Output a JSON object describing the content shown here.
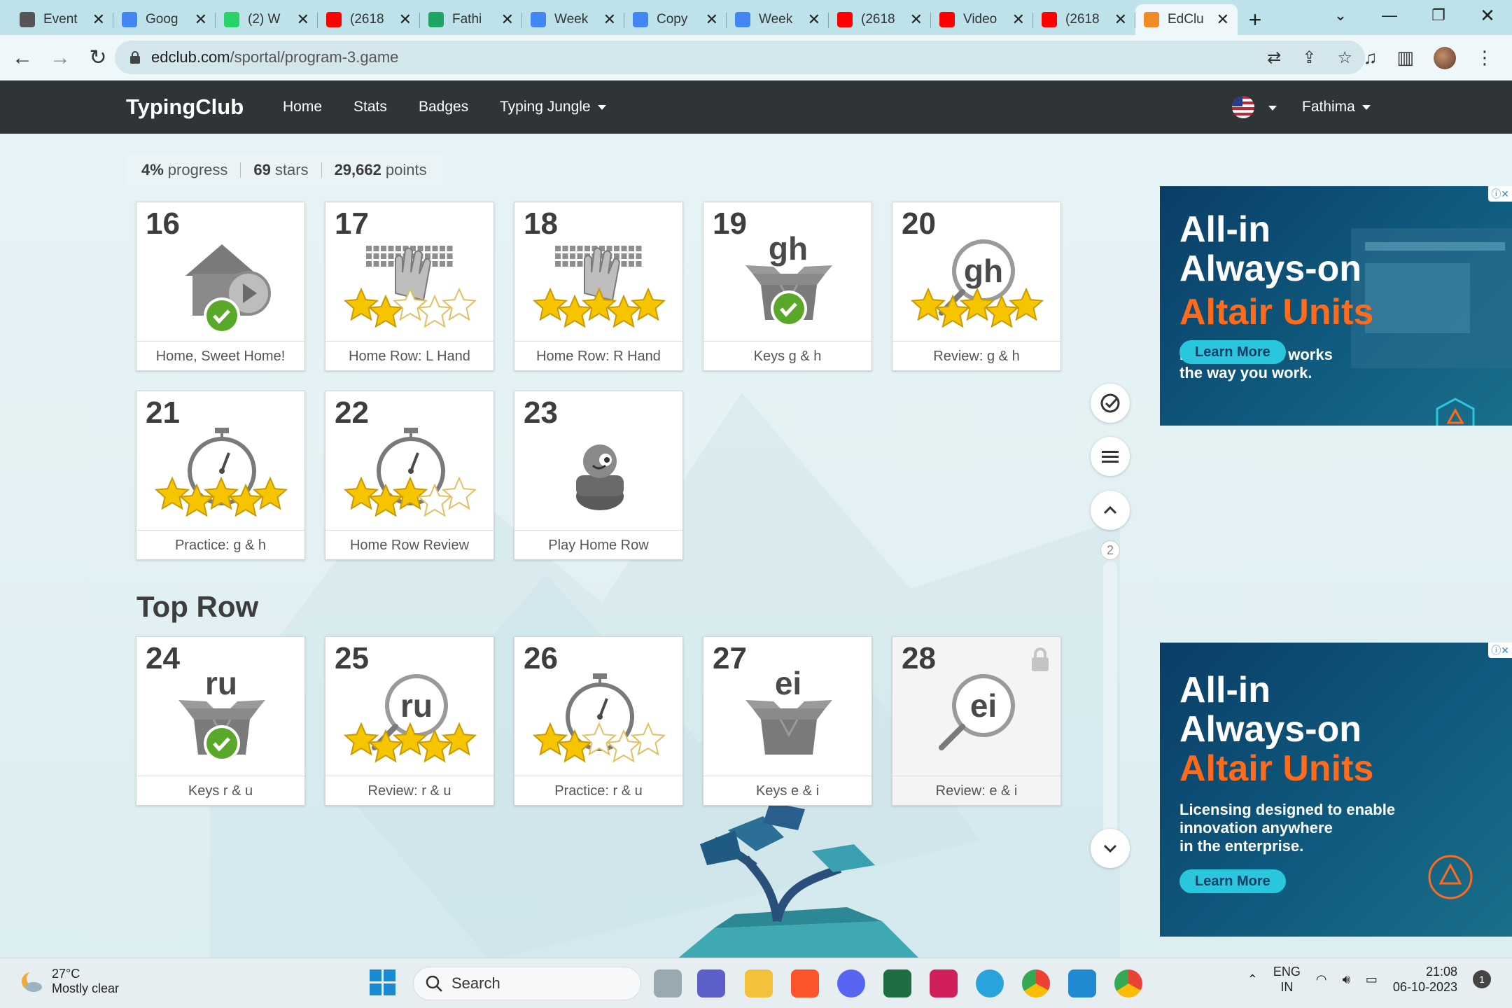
{
  "browser": {
    "tabs": [
      {
        "title": "Event",
        "icon": "openai-icon",
        "color": "#555555"
      },
      {
        "title": "Goog",
        "icon": "google-icon",
        "color": "#4285f4"
      },
      {
        "title": "(2) W",
        "icon": "whatsapp-icon",
        "color": "#25d366"
      },
      {
        "title": "(2618",
        "icon": "youtube-icon",
        "color": "#ff0000"
      },
      {
        "title": "Fathi",
        "icon": "drive-icon",
        "color": "#1fa463"
      },
      {
        "title": "Week",
        "icon": "docs-icon",
        "color": "#4285f4"
      },
      {
        "title": "Copy",
        "icon": "docs-icon",
        "color": "#4285f4"
      },
      {
        "title": "Week",
        "icon": "docs-icon",
        "color": "#4285f4"
      },
      {
        "title": "(2618",
        "icon": "youtube-icon",
        "color": "#ff0000"
      },
      {
        "title": "Video",
        "icon": "youtube-icon",
        "color": "#ff0000"
      },
      {
        "title": "(2618",
        "icon": "youtube-icon",
        "color": "#ff0000"
      },
      {
        "title": "EdClu",
        "icon": "edclub-icon",
        "color": "#f08a24",
        "active": true
      }
    ],
    "url_domain": "edclub.com",
    "url_path": "/sportal/program-3.game"
  },
  "site": {
    "brand": "TypingClub",
    "nav": [
      "Home",
      "Stats",
      "Badges",
      "Typing Jungle"
    ],
    "user": "Fathima"
  },
  "stats": {
    "progress_value": "4%",
    "progress_label": "progress",
    "stars_value": "69",
    "stars_label": "stars",
    "points_value": "29,662",
    "points_label": "points"
  },
  "lessons_row1": [
    {
      "num": "16",
      "label": "Home, Sweet Home!",
      "art": "home-video",
      "stars": 0,
      "done": true
    },
    {
      "num": "17",
      "label": "Home Row: L Hand",
      "art": "keyboard-hand",
      "stars": 2
    },
    {
      "num": "18",
      "label": "Home Row: R Hand",
      "art": "keyboard-hand",
      "stars": 5
    },
    {
      "num": "19",
      "label": "Keys g & h",
      "art": "box",
      "keys": "gh",
      "done": true
    },
    {
      "num": "20",
      "label": "Review: g & h",
      "art": "magnifier",
      "keys": "gh",
      "stars": 5
    }
  ],
  "lessons_row2": [
    {
      "num": "21",
      "label": "Practice: g & h",
      "art": "stopwatch",
      "stars": 5
    },
    {
      "num": "22",
      "label": "Home Row Review",
      "art": "stopwatch",
      "stars": 3
    },
    {
      "num": "23",
      "label": "Play Home Row",
      "art": "game",
      "stars": 0
    }
  ],
  "section_title": "Top Row",
  "lessons_row3": [
    {
      "num": "24",
      "label": "Keys r & u",
      "art": "box",
      "keys": "ru",
      "done": true
    },
    {
      "num": "25",
      "label": "Review: r & u",
      "art": "magnifier",
      "keys": "ru",
      "stars": 5
    },
    {
      "num": "26",
      "label": "Practice: r & u",
      "art": "stopwatch",
      "stars": 2
    },
    {
      "num": "27",
      "label": "Keys e & i",
      "art": "box",
      "keys": "ei"
    },
    {
      "num": "28",
      "label": "Review: e & i",
      "art": "magnifier",
      "keys": "ei",
      "locked": true
    }
  ],
  "page_indicator": "2",
  "ads": [
    {
      "line1": "All-in",
      "line2": "Always-on",
      "line3": "Altair Units",
      "sub": "Licensing that works\nthe way you work.",
      "cta": "Learn More"
    },
    {
      "line1": "All-in",
      "line2": "Always-on",
      "line3": "Altair Units",
      "sub": "Licensing designed to enable\ninnovation anywhere\nin the enterprise.",
      "cta": "Learn More"
    }
  ],
  "taskbar": {
    "temp": "27°C",
    "weather": "Mostly clear",
    "search": "Search",
    "lang1": "ENG",
    "lang2": "IN",
    "time": "21:08",
    "date": "06-10-2023",
    "notif": "1"
  },
  "colors": {
    "accent_star": "#f7c400",
    "check_green": "#5aa829",
    "nav_bg": "#2f3437",
    "ad_orange": "#ff6b1a"
  }
}
